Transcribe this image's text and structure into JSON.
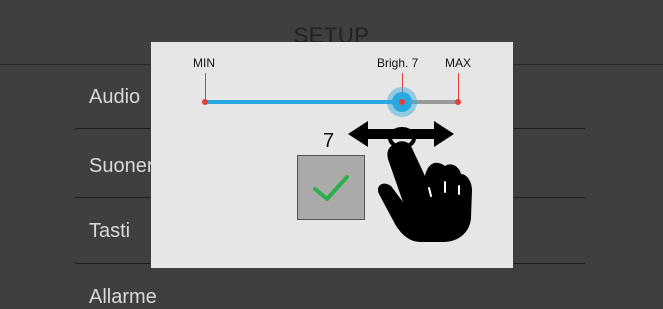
{
  "screen": {
    "title": "SETUP",
    "menu": [
      {
        "label": "Audio"
      },
      {
        "label": "Suoneria"
      },
      {
        "label": "Tasti"
      },
      {
        "label": "Allarme"
      }
    ]
  },
  "overlay": {
    "slider": {
      "min_label": "MIN",
      "max_label": "MAX",
      "current_label": "Brigh. 7",
      "value": 7,
      "value_fraction": 0.78
    },
    "value_display": "7",
    "confirm_icon": "checkmark-icon",
    "gesture_icon": "hand-swipe-icon",
    "colors": {
      "accent": "#29a8e0",
      "marker": "#e0403a",
      "check": "#2bb04a"
    }
  }
}
